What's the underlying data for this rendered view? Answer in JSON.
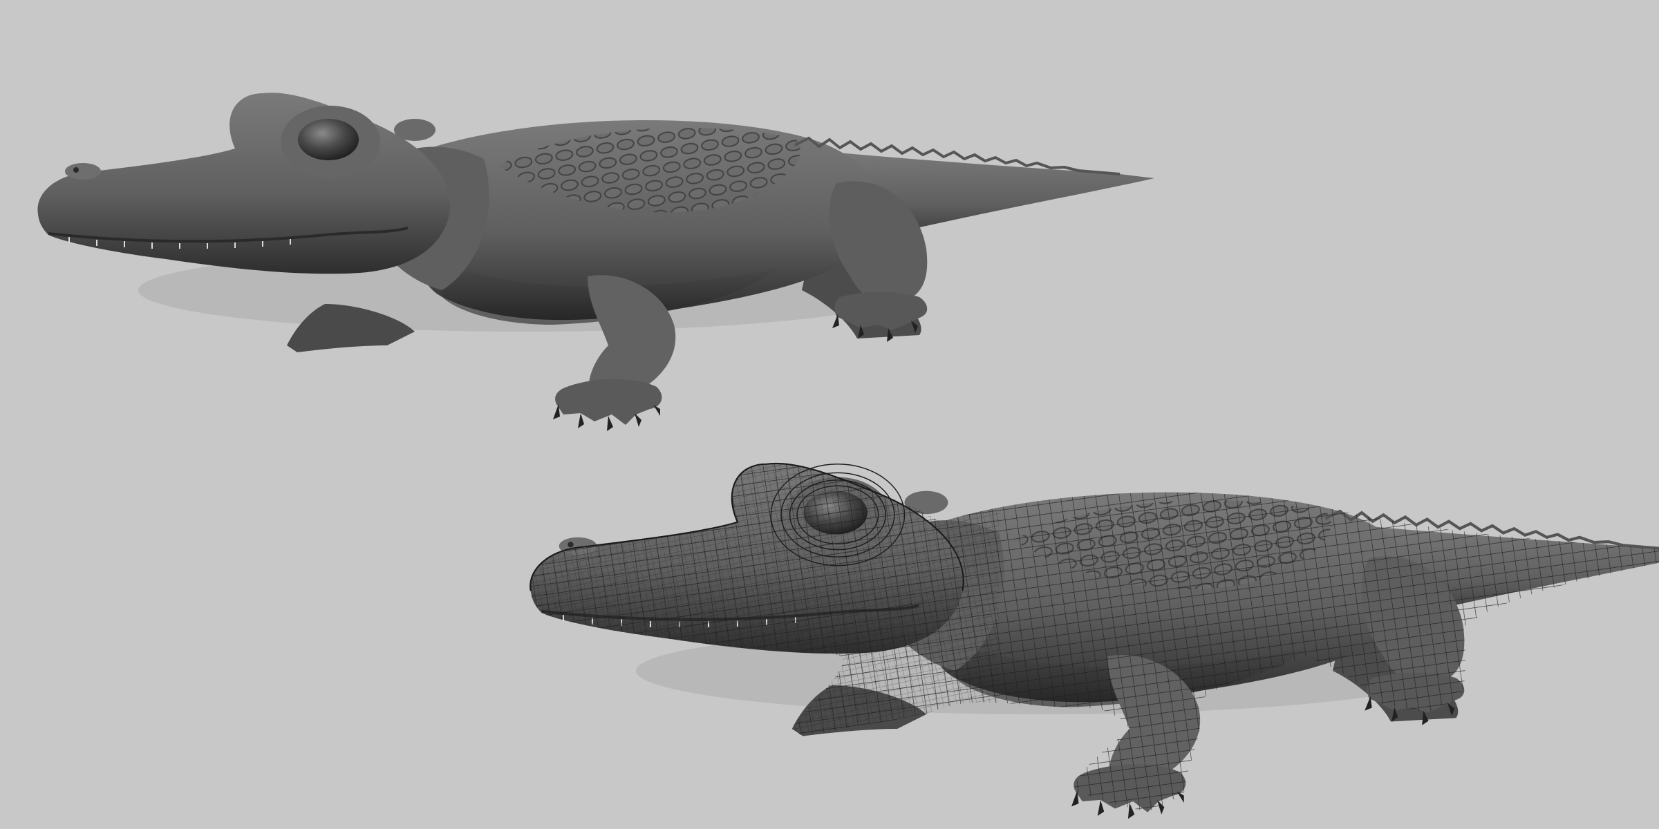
{
  "scene": {
    "background_color": "#c8c8c8",
    "models": [
      {
        "id": "gator-smooth",
        "display_mode": "smooth-shaded",
        "base_color": "#6a6a6a"
      },
      {
        "id": "gator-wireframe",
        "display_mode": "shaded-with-wireframe",
        "base_color": "#6e6e6e",
        "wire_color": "#1e1e1e"
      }
    ]
  }
}
